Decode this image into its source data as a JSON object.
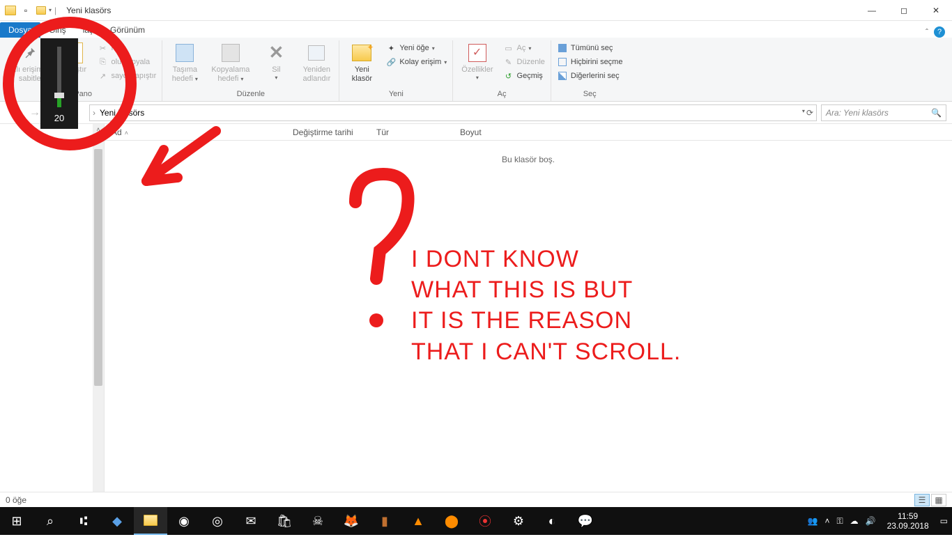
{
  "title": "Yeni klasörs",
  "tabs": {
    "file": "Dosya",
    "home": "Giriş",
    "share": "laş",
    "view": "Görünüm"
  },
  "ribbon": {
    "pin": {
      "l1": "zlı erişime",
      "l2": "sabitle"
    },
    "paste": "Yapıştır",
    "cut": "Kes",
    "copypath": "olu kopyala",
    "pasteshortcut": "sayol yapıştır",
    "g_pano": "Pano",
    "moveto": {
      "l1": "Taşıma",
      "l2": "hedefi"
    },
    "copyto": {
      "l1": "Kopyalama",
      "l2": "hedefi"
    },
    "delete": "Sil",
    "rename": {
      "l1": "Yeniden",
      "l2": "adlandır"
    },
    "g_duzenle": "Düzenle",
    "newfolder": {
      "l1": "Yeni",
      "l2": "klasör"
    },
    "newitem": "Yeni öğe",
    "easyaccess": "Kolay erişim",
    "g_yeni": "Yeni",
    "properties": "Özellikler",
    "open": "Aç",
    "edit": "Düzenle",
    "history": "Geçmiş",
    "g_ac": "Aç",
    "selall": "Tümünü seç",
    "selnone": "Hiçbirini seçme",
    "selinv": "Diğerlerini seç",
    "g_sec": "Seç"
  },
  "breadcrumb": {
    "current": "Yeni klasörs"
  },
  "search": {
    "placeholder": "Ara: Yeni klasörs"
  },
  "columns": {
    "name": "Ad",
    "modified": "Değiştirme tarihi",
    "type": "Tür",
    "size": "Boyut"
  },
  "empty": "Bu klasör boş.",
  "status": "0 öğe",
  "volume": "20",
  "clock": {
    "time": "11:59",
    "date": "23.09.2018"
  },
  "annotation": {
    "l1": "I DONT KNOW",
    "l2": "WHAT THIS IS BUT",
    "l3": "IT IS THE REASON",
    "l4": " THAT I CAN'T SCROLL."
  }
}
